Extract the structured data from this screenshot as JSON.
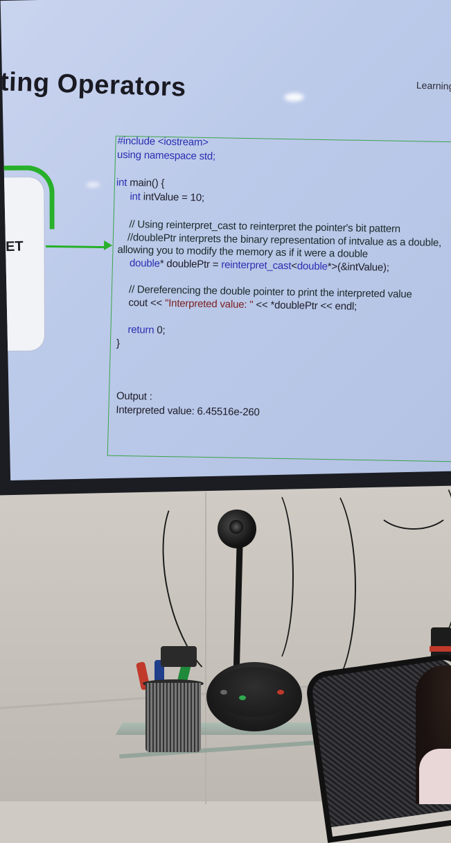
{
  "slide": {
    "title": "ting Operators",
    "brand": "Learning &",
    "left_card_text": "ET"
  },
  "code": {
    "lines": [
      "#include <iostream>",
      "using namespace std;",
      "",
      "int main() {",
      "    int intValue = 10;",
      "",
      "    // Using reinterpret_cast to reinterpret the pointer's bit pattern",
      "    //doublePtr interprets the binary representation of intvalue as a double,",
      "allowing you to modify the memory as if it were a double",
      "    double* doublePtr = reinterpret_cast<double*>(&intValue);",
      "",
      "    // Dereferencing the double pointer to print the interpreted value",
      "    cout << \"Interpreted value: \" << *doublePtr << endl;",
      "",
      "    return 0;",
      "}"
    ],
    "output_label": "Output :",
    "output_value": "Interpreted value: 6.45516e-260"
  },
  "colors": {
    "screen": "#bccaea",
    "accent_green": "#27b02a",
    "keyword_blue": "#2a2fb0",
    "bezel": "#1b1d22"
  },
  "objects": {
    "webcam": "webcam-icon",
    "speakerphone": "speakerphone-icon",
    "marker_cup": "pen-cup-icon",
    "office_chair": "chair-icon"
  }
}
